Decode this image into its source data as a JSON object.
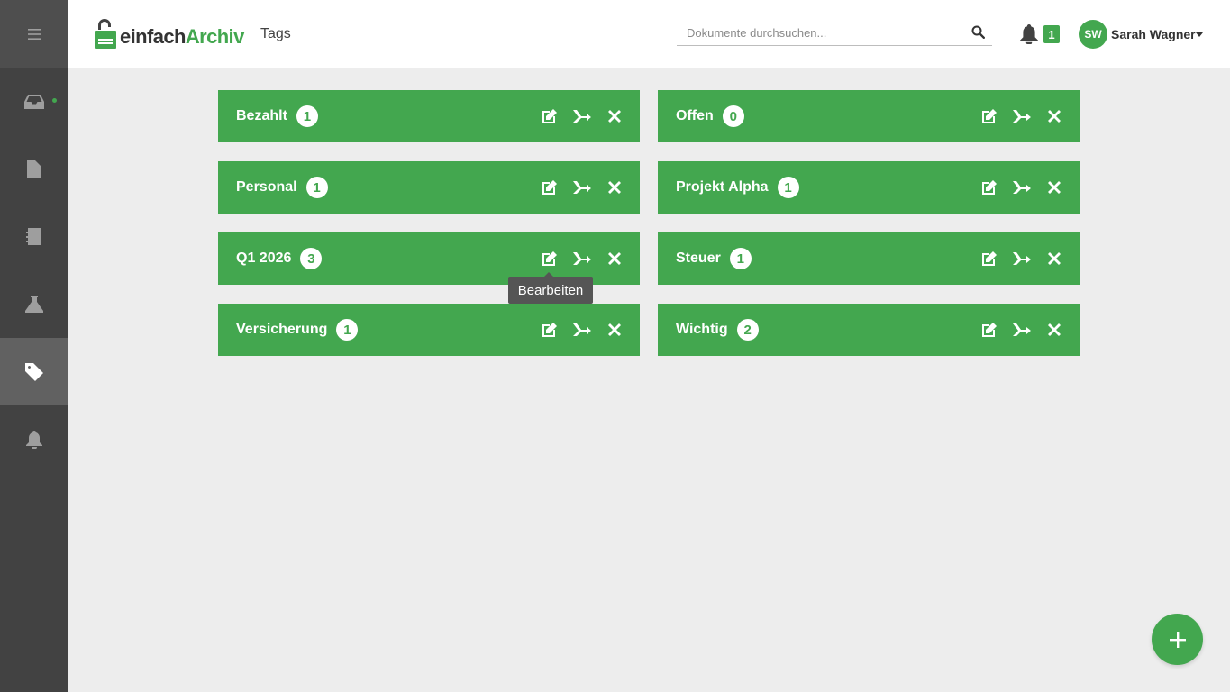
{
  "app": {
    "logo_part1": "einfach",
    "logo_part2": "Archiv",
    "page_title": "Tags"
  },
  "search": {
    "placeholder": "Dokumente durchsuchen...",
    "value": ""
  },
  "notifications": {
    "count": "1"
  },
  "user": {
    "initials": "SW",
    "name": "Sarah Wagner"
  },
  "sidebar": {
    "items": [
      {
        "name": "menu",
        "icon": "hamburger-icon"
      },
      {
        "name": "inbox",
        "icon": "inbox-icon",
        "has_indicator": true
      },
      {
        "name": "documents",
        "icon": "document-icon"
      },
      {
        "name": "address-book",
        "icon": "address-book-icon"
      },
      {
        "name": "lab",
        "icon": "flask-icon"
      },
      {
        "name": "tags",
        "icon": "tag-icon",
        "active": true
      },
      {
        "name": "notifications",
        "icon": "bell-icon"
      }
    ]
  },
  "tags": [
    {
      "name": "Bezahlt",
      "count": "1"
    },
    {
      "name": "Offen",
      "count": "0"
    },
    {
      "name": "Personal",
      "count": "1"
    },
    {
      "name": "Projekt Alpha",
      "count": "1"
    },
    {
      "name": "Q1 2026",
      "count": "3"
    },
    {
      "name": "Steuer",
      "count": "1"
    },
    {
      "name": "Versicherung",
      "count": "1"
    },
    {
      "name": "Wichtig",
      "count": "2"
    }
  ],
  "tooltip": {
    "text": "Bearbeiten"
  },
  "colors": {
    "accent": "#43a74f",
    "sidebar": "#424242",
    "background": "#ededed"
  }
}
